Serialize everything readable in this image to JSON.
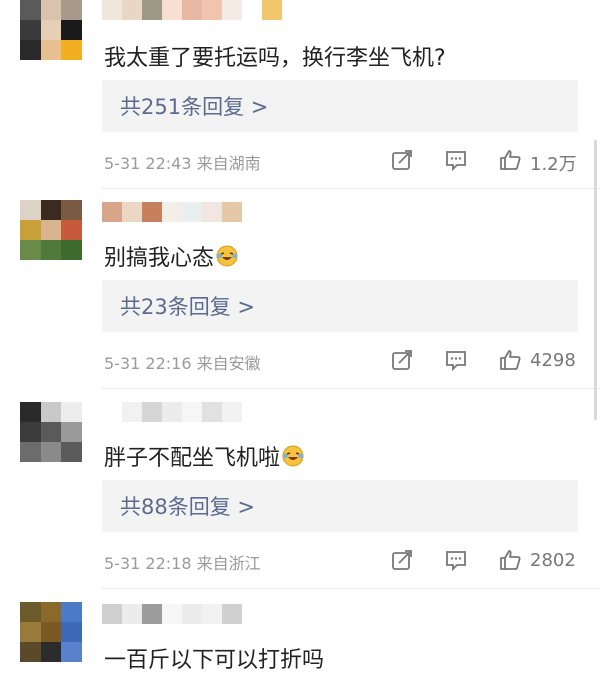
{
  "comments": [
    {
      "text": "我太重了要托运吗，换行李坐飞机?",
      "reply_link": "共251条回复 >",
      "meta": "5-31 22:43  来自湖南",
      "likes": "1.2万",
      "emoji": false
    },
    {
      "text": "别搞我心态",
      "reply_link": "共23条回复 >",
      "meta": "5-31 22:16  来自安徽",
      "likes": "4298",
      "emoji": true
    },
    {
      "text": "胖子不配坐飞机啦",
      "reply_link": "共88条回复 >",
      "meta": "5-31 22:18  来自浙江",
      "likes": "2802",
      "emoji": true
    },
    {
      "text": "一百斤以下可以打折吗",
      "emoji": false
    }
  ],
  "icons": {
    "share": "share-icon",
    "comment": "comment-icon",
    "like": "thumbs-up-icon",
    "emoji": "laughing-tears-emoji-icon"
  },
  "colors": {
    "reply_link": "#5b6a8f",
    "reply_bg": "#f3f3f3",
    "meta_text": "#9a9a9a"
  }
}
